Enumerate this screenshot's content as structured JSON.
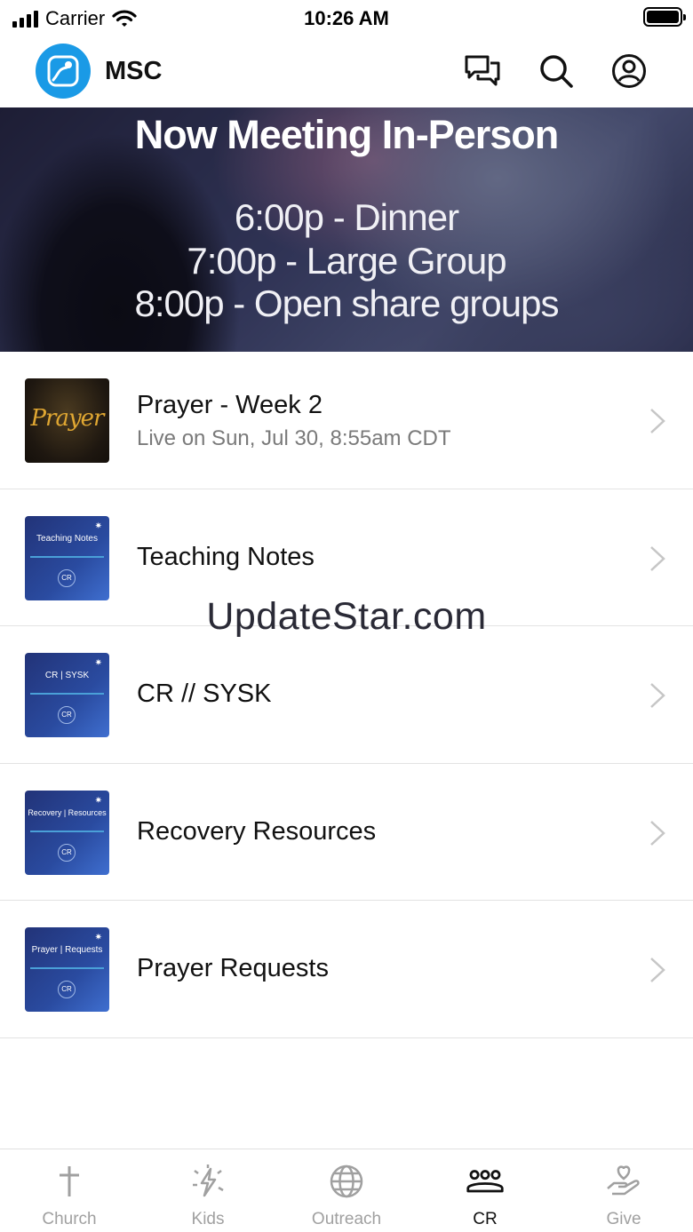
{
  "status_bar": {
    "carrier": "Carrier",
    "time": "10:26 AM"
  },
  "header": {
    "app_name": "MSC",
    "icons": [
      "chat-bubbles-icon",
      "search-icon",
      "profile-icon"
    ]
  },
  "banner": {
    "title": "Now Meeting In-Person",
    "lines": [
      "6:00p - Dinner",
      "7:00p - Large Group",
      "8:00p - Open share groups"
    ]
  },
  "list": {
    "items": [
      {
        "title": "Prayer - Week 2",
        "subtitle": "Live on Sun, Jul 30, 8:55am CDT",
        "thumb_text": "Prayer"
      },
      {
        "title": "Teaching Notes",
        "thumb_text": "Teaching Notes",
        "thumb_badge": "CR"
      },
      {
        "title": "CR // SYSK",
        "thumb_text": "CR | SYSK",
        "thumb_badge": "CR"
      },
      {
        "title": "Recovery Resources",
        "thumb_text": "Recovery | Resources",
        "thumb_badge": "CR"
      },
      {
        "title": "Prayer Requests",
        "thumb_text": "Prayer | Requests",
        "thumb_badge": "CR"
      }
    ]
  },
  "watermark": "UpdateStar.com",
  "tabbar": {
    "tabs": [
      {
        "label": "Church",
        "icon": "cross-icon",
        "active": false
      },
      {
        "label": "Kids",
        "icon": "sparkle-bolt-icon",
        "active": false
      },
      {
        "label": "Outreach",
        "icon": "globe-icon",
        "active": false
      },
      {
        "label": "CR",
        "icon": "group-icon",
        "active": true
      },
      {
        "label": "Give",
        "icon": "heart-hand-icon",
        "active": false
      }
    ]
  },
  "colors": {
    "brand": "#1a9ae6",
    "active_tab": "#111111",
    "inactive_tab": "#a0a0a0"
  }
}
